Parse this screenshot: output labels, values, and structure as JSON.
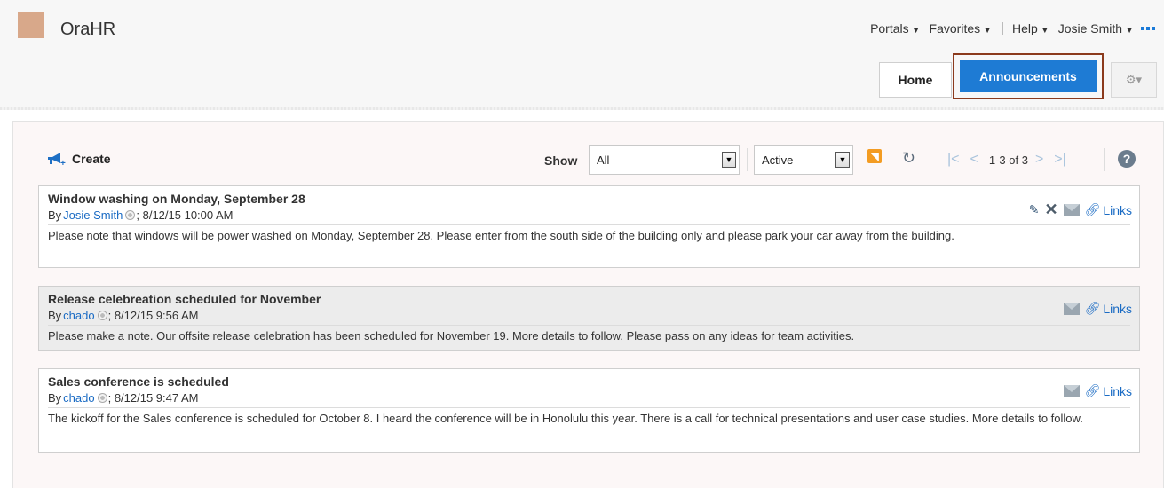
{
  "app": {
    "name": "OraHR"
  },
  "topnav": {
    "portals": "Portals",
    "favorites": "Favorites",
    "help": "Help",
    "user": "Josie Smith"
  },
  "tabs": {
    "home": "Home",
    "announcements": "Announcements"
  },
  "toolbar": {
    "create": "Create",
    "show_label": "Show",
    "show_value": "All",
    "status_value": "Active",
    "page_count": "1-3 of 3"
  },
  "announcements": [
    {
      "title": "Window washing on Monday, September 28",
      "by": "By",
      "author": "Josie Smith",
      "date": "; 8/12/15 10:00 AM",
      "body": "Please note that windows will be power washed on Monday, September 28. Please enter from the south side of the building only and please park your car away from the building.",
      "links": "Links"
    },
    {
      "title": "Release celebreation scheduled for November",
      "by": "By",
      "author": "chado",
      "date": "; 8/12/15 9:56 AM",
      "body": "Please make a note. Our offsite release celebration has been scheduled for November 19. More details to follow. Please pass on any ideas for team activities.",
      "links": "Links"
    },
    {
      "title": "Sales conference is scheduled",
      "by": "By",
      "author": "chado",
      "date": "; 8/12/15 9:47 AM",
      "body": "The kickoff for the Sales conference is scheduled for October 8. I heard the conference will be in Honolulu this year. There is a call for technical presentations and user case studies. More details to follow.",
      "links": "Links"
    }
  ],
  "colors": {
    "accent": "#1e7bd4",
    "highlight_border": "#8b3a1d",
    "link": "#1a6bc4"
  }
}
